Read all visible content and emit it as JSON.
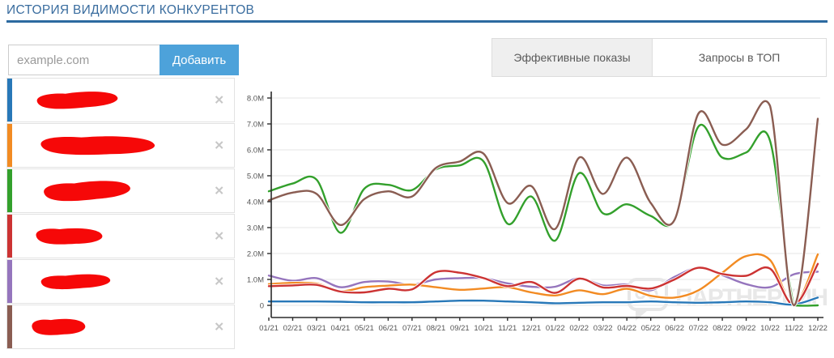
{
  "page": {
    "title": "ИСТОРИЯ ВИДИМОСТИ КОНКУРЕНТОВ"
  },
  "add_form": {
    "placeholder": "example.com",
    "button_label": "Добавить"
  },
  "tabs": [
    {
      "label": "Эффективные показы",
      "active": true
    },
    {
      "label": "Запросы в ТОП",
      "active": false
    }
  ],
  "list": {
    "remove_icon": "✕",
    "note": "competitor domain names are painted over with red marker scribbles"
  },
  "competitors": [
    {
      "color": "#2878b8",
      "redacted": true
    },
    {
      "color": "#f28b23",
      "redacted": true
    },
    {
      "color": "#33a02c",
      "redacted": true
    },
    {
      "color": "#cc3333",
      "redacted": true
    },
    {
      "color": "#9575bd",
      "redacted": true
    },
    {
      "color": "#8a5d52",
      "redacted": true
    }
  ],
  "watermark": {
    "text": "ПАРТНЕРКИН"
  },
  "chart_data": {
    "type": "line",
    "title": "",
    "xlabel": "",
    "ylabel": "",
    "grid": "horizontal",
    "legend_position": "none (series colors match competitor list bars)",
    "ylim": [
      0,
      8.4
    ],
    "ytick_labels": [
      "0",
      "1.0M",
      "2.0M",
      "3.0M",
      "4.0M",
      "5.0M",
      "6.0M",
      "7.0M",
      "8.0M"
    ],
    "x": [
      "01/21",
      "02/21",
      "03/21",
      "04/21",
      "05/21",
      "06/21",
      "07/21",
      "08/21",
      "09/21",
      "10/21",
      "11/21",
      "12/21",
      "01/22",
      "02/22",
      "03/22",
      "04/22",
      "05/22",
      "06/22",
      "07/22",
      "08/22",
      "09/22",
      "10/22",
      "11/22",
      "12/22"
    ],
    "series": [
      {
        "name": "competitor-1-blue",
        "color": "#2878b8",
        "values": [
          0.15,
          0.15,
          0.15,
          0.14,
          0.12,
          0.12,
          0.12,
          0.15,
          0.18,
          0.18,
          0.15,
          0.12,
          0.08,
          0.1,
          0.12,
          0.12,
          0.15,
          0.12,
          0.1,
          0.12,
          0.15,
          0.12,
          0.03,
          0.3
        ]
      },
      {
        "name": "competitor-2-orange",
        "color": "#f28b23",
        "values": [
          0.82,
          0.87,
          0.84,
          0.55,
          0.7,
          0.76,
          0.8,
          0.7,
          0.6,
          0.65,
          0.7,
          0.5,
          0.38,
          0.58,
          0.43,
          0.64,
          0.37,
          0.3,
          0.58,
          1.26,
          1.9,
          1.75,
          0.02,
          1.97
        ]
      },
      {
        "name": "competitor-3-green",
        "color": "#33a02c",
        "values": [
          4.4,
          4.7,
          4.85,
          2.8,
          4.5,
          4.65,
          4.45,
          5.25,
          5.4,
          5.55,
          3.15,
          4.2,
          2.5,
          5.1,
          3.55,
          3.9,
          3.45,
          3.3,
          6.9,
          5.7,
          5.9,
          6.35,
          0.0,
          0.0
        ]
      },
      {
        "name": "competitor-4-red",
        "color": "#cc3333",
        "values": [
          0.74,
          0.77,
          0.79,
          0.53,
          0.5,
          0.64,
          0.62,
          1.28,
          1.26,
          1.05,
          0.74,
          0.9,
          0.48,
          1.03,
          0.69,
          0.75,
          0.65,
          1.0,
          1.45,
          1.21,
          1.14,
          1.42,
          0.02,
          1.6
        ]
      },
      {
        "name": "competitor-5-purple",
        "color": "#9575bd",
        "values": [
          1.15,
          0.95,
          1.05,
          0.7,
          0.9,
          0.92,
          0.8,
          1.0,
          1.05,
          1.05,
          0.85,
          0.72,
          0.72,
          1.05,
          0.77,
          0.8,
          0.58,
          1.1,
          1.45,
          1.16,
          0.82,
          0.7,
          1.2,
          1.3
        ]
      },
      {
        "name": "competitor-6-brown",
        "color": "#8a5d52",
        "values": [
          4.05,
          4.35,
          4.3,
          3.1,
          4.1,
          4.4,
          4.2,
          5.3,
          5.55,
          5.85,
          3.95,
          4.6,
          2.95,
          5.7,
          4.3,
          5.7,
          3.95,
          3.3,
          7.4,
          6.2,
          6.8,
          7.7,
          0.0,
          7.2
        ]
      }
    ]
  }
}
